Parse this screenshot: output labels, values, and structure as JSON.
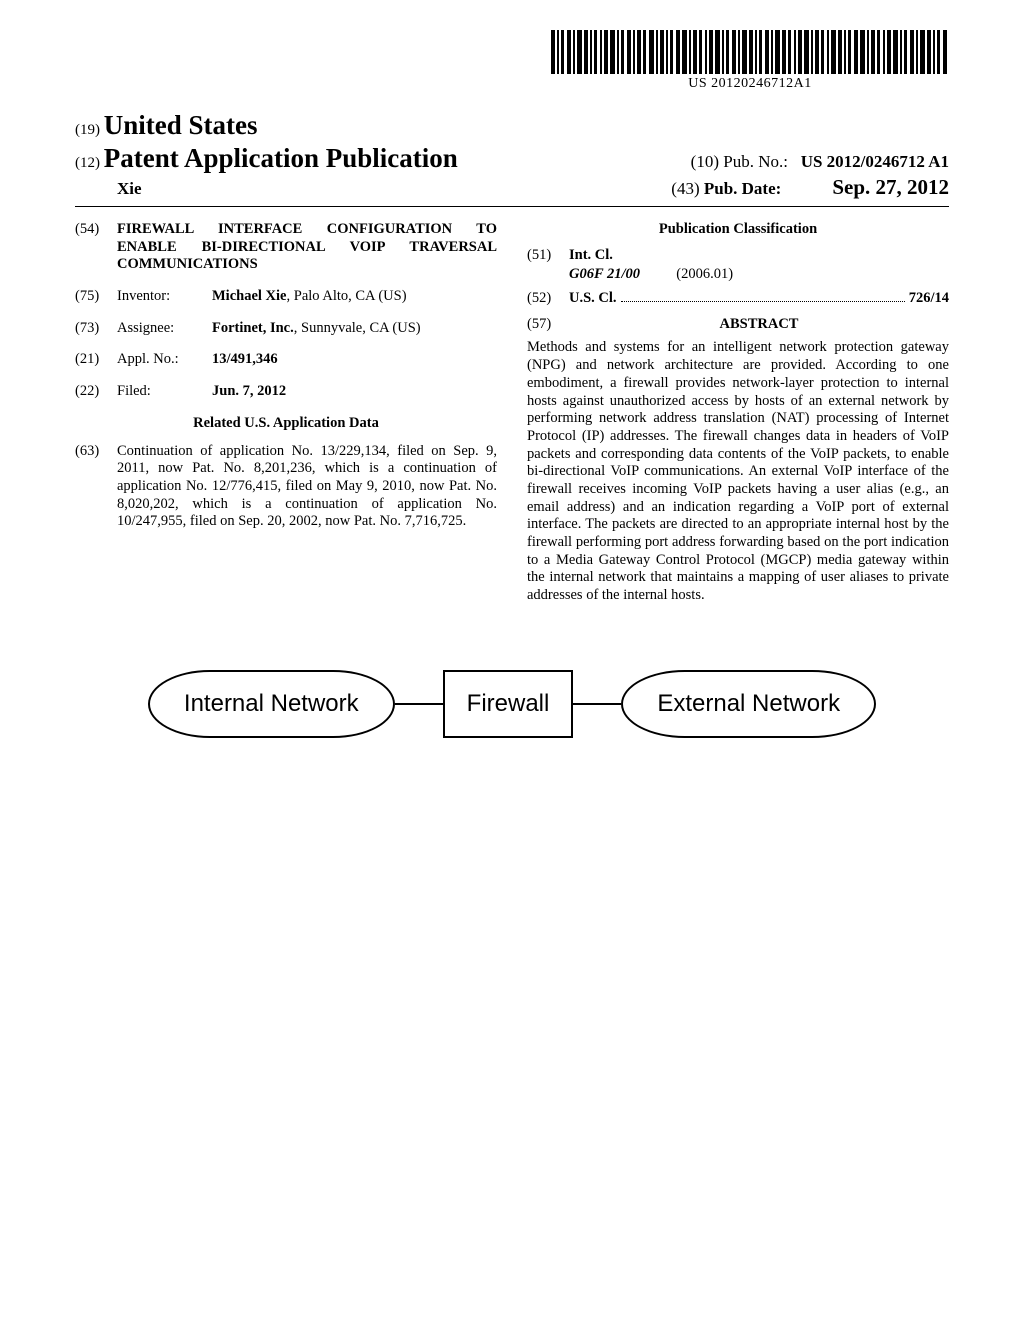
{
  "barcode_text": "US 20120246712A1",
  "header": {
    "country_code": "(19)",
    "country": "United States",
    "pub_code": "(12)",
    "pub_label": "Patent Application Publication",
    "pubno_code": "(10)",
    "pubno_label": "Pub. No.:",
    "pubno_value": "US 2012/0246712 A1",
    "author": "Xie",
    "pubdate_code": "(43)",
    "pubdate_label": "Pub. Date:",
    "pubdate_value": "Sep. 27, 2012"
  },
  "left": {
    "title_code": "(54)",
    "title": "FIREWALL INTERFACE CONFIGURATION TO ENABLE BI-DIRECTIONAL VOIP TRAVERSAL COMMUNICATIONS",
    "inventor_code": "(75)",
    "inventor_label": "Inventor:",
    "inventor_name": "Michael Xie",
    "inventor_loc": ", Palo Alto, CA (US)",
    "assignee_code": "(73)",
    "assignee_label": "Assignee:",
    "assignee_name": "Fortinet, Inc.",
    "assignee_loc": ", Sunnyvale, CA (US)",
    "applno_code": "(21)",
    "applno_label": "Appl. No.:",
    "applno_value": "13/491,346",
    "filed_code": "(22)",
    "filed_label": "Filed:",
    "filed_value": "Jun. 7, 2012",
    "related_header": "Related U.S. Application Data",
    "related_code": "(63)",
    "related_text": "Continuation of application No. 13/229,134, filed on Sep. 9, 2011, now Pat. No. 8,201,236, which is a continuation of application No. 12/776,415, filed on May 9, 2010, now Pat. No. 8,020,202, which is a continuation of application No. 10/247,955, filed on Sep. 20, 2002, now Pat. No. 7,716,725."
  },
  "right": {
    "pubclass_header": "Publication Classification",
    "intcl_code": "(51)",
    "intcl_label": "Int. Cl.",
    "intcl_class": "G06F 21/00",
    "intcl_year": "(2006.01)",
    "uscl_code": "(52)",
    "uscl_label": "U.S. Cl.",
    "uscl_value": "726/14",
    "abstract_code": "(57)",
    "abstract_label": "ABSTRACT",
    "abstract_body": "Methods and systems for an intelligent network protection gateway (NPG) and network architecture are provided. According to one embodiment, a firewall provides network-layer protection to internal hosts against unauthorized access by hosts of an external network by performing network address translation (NAT) processing of Internet Protocol (IP) addresses. The firewall changes data in headers of VoIP packets and corresponding data contents of the VoIP packets, to enable bi-directional VoIP communications. An external VoIP interface of the firewall receives incoming VoIP packets having a user alias (e.g., an email address) and an indication regarding a VoIP port of external interface. The packets are directed to an appropriate internal host by the firewall performing port address forwarding based on the port indication to a Media Gateway Control Protocol (MGCP) media gateway within the internal network that maintains a mapping of user aliases to private addresses of the internal hosts."
  },
  "chart_data": {
    "type": "diagram",
    "nodes": [
      {
        "id": "internal",
        "label": "Internal Network",
        "shape": "oval"
      },
      {
        "id": "firewall",
        "label": "Firewall",
        "shape": "rect"
      },
      {
        "id": "external",
        "label": "External Network",
        "shape": "oval"
      }
    ],
    "edges": [
      {
        "from": "internal",
        "to": "firewall"
      },
      {
        "from": "firewall",
        "to": "external"
      }
    ]
  }
}
